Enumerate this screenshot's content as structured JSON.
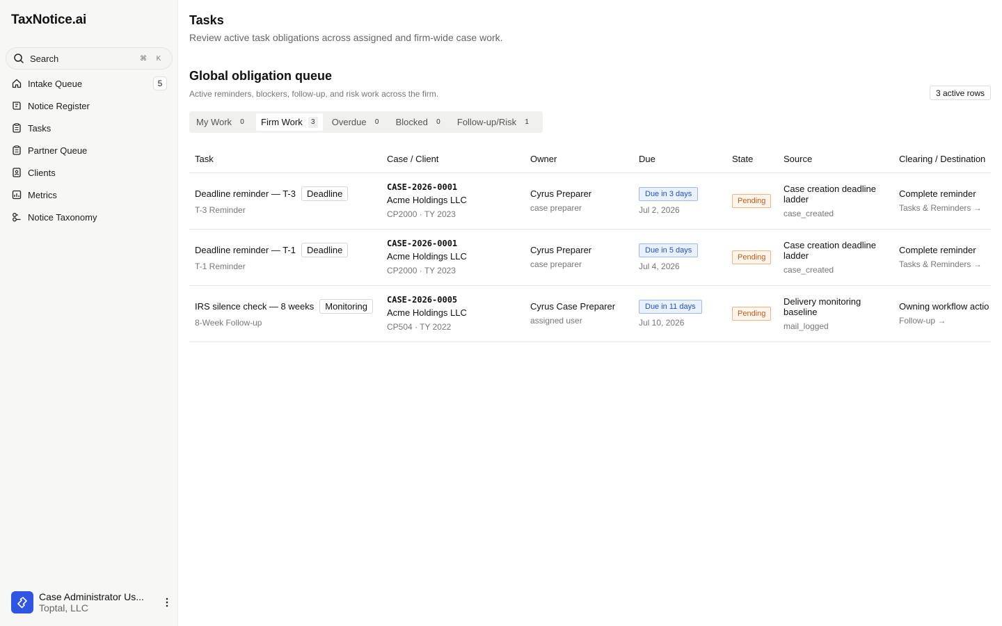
{
  "app": {
    "brand": "TaxNotice.ai"
  },
  "search": {
    "label": "Search",
    "kbd1": "⌘",
    "kbd2": "K"
  },
  "nav": [
    {
      "label": "Intake Queue",
      "icon": "home-icon",
      "count": "5"
    },
    {
      "label": "Notice Register",
      "icon": "register-icon"
    },
    {
      "label": "Tasks",
      "icon": "clipboard-icon"
    },
    {
      "label": "Partner Queue",
      "icon": "clipboard-icon"
    },
    {
      "label": "Clients",
      "icon": "contacts-icon"
    },
    {
      "label": "Metrics",
      "icon": "chart-icon"
    },
    {
      "label": "Notice Taxonomy",
      "icon": "taxonomy-icon"
    }
  ],
  "user": {
    "name": "Case Administrator Us...",
    "org": "Toptal, LLC"
  },
  "page": {
    "title": "Tasks",
    "subtitle": "Review active task obligations across assigned and firm-wide case work."
  },
  "section": {
    "title": "Global obligation queue",
    "subtitle": "Active reminders, blockers, follow-up, and risk work across the firm.",
    "rows_badge": "3 active rows"
  },
  "tabs": [
    {
      "label": "My Work",
      "count": "0"
    },
    {
      "label": "Firm Work",
      "count": "3"
    },
    {
      "label": "Overdue",
      "count": "0"
    },
    {
      "label": "Blocked",
      "count": "0"
    },
    {
      "label": "Follow-up/Risk",
      "count": "1"
    }
  ],
  "active_tab": "Firm Work",
  "table": {
    "headers": [
      "Task",
      "Case / Client",
      "Owner",
      "Due",
      "State",
      "Source",
      "Clearing / Destination"
    ],
    "rows": [
      {
        "task": "Deadline reminder — T-3",
        "tag": "Deadline",
        "task_sub": "T-3 Reminder",
        "case": "CASE-2026-0001",
        "client": "Acme Holdings LLC",
        "notice": "CP2000 · TY 2023",
        "owner": "Cyrus Preparer",
        "owner_role": "case preparer",
        "due_badge": "Due in 3 days",
        "due_date": "Jul 2, 2026",
        "state": "Pending",
        "source": "Case creation deadline ladder",
        "source_code": "case_created",
        "clearing": "Complete reminder",
        "destination": "Tasks & Reminders →"
      },
      {
        "task": "Deadline reminder — T-1",
        "tag": "Deadline",
        "task_sub": "T-1 Reminder",
        "case": "CASE-2026-0001",
        "client": "Acme Holdings LLC",
        "notice": "CP2000 · TY 2023",
        "owner": "Cyrus Preparer",
        "owner_role": "case preparer",
        "due_badge": "Due in 5 days",
        "due_date": "Jul 4, 2026",
        "state": "Pending",
        "source": "Case creation deadline ladder",
        "source_code": "case_created",
        "clearing": "Complete reminder",
        "destination": "Tasks & Reminders →"
      },
      {
        "task": "IRS silence check — 8 weeks",
        "tag": "Monitoring",
        "task_sub": "8-Week Follow-up",
        "case": "CASE-2026-0005",
        "client": "Acme Holdings LLC",
        "notice": "CP504 · TY 2022",
        "owner": "Cyrus Case Preparer",
        "owner_role": "assigned user",
        "due_badge": "Due in 11 days",
        "due_date": "Jul 10, 2026",
        "state": "Pending",
        "source": "Delivery monitoring baseline",
        "source_code": "mail_logged",
        "clearing": "Owning workflow actio",
        "destination": "Follow-up →"
      }
    ]
  },
  "colors": {
    "accent": "#2f55e4",
    "due_blue": "#1d4fd8",
    "pending_orange": "#c65a14"
  }
}
